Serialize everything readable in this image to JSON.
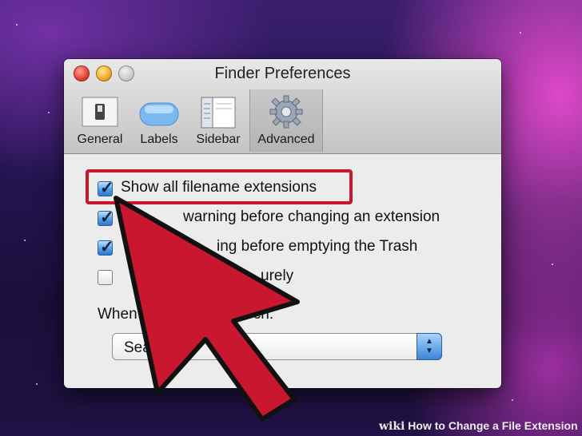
{
  "window": {
    "title": "Finder Preferences"
  },
  "toolbar": {
    "tabs": [
      {
        "label": "General",
        "icon": "switch-icon"
      },
      {
        "label": "Labels",
        "icon": "label-pill-icon"
      },
      {
        "label": "Sidebar",
        "icon": "sidebar-window-icon"
      },
      {
        "label": "Advanced",
        "icon": "gear-icon",
        "selected": true
      }
    ]
  },
  "options": [
    {
      "label": "Show all filename extensions",
      "checked": true
    },
    {
      "label": "warning before changing an extension",
      "checked": true
    },
    {
      "label": "ing before emptying the Trash",
      "checked": true
    },
    {
      "label": "urely",
      "checked": false
    }
  ],
  "search": {
    "label": "When",
    "label_end": "a search:",
    "select_value": "Sea"
  },
  "watermark": {
    "brand": "wiki",
    "text": "How to Change a File Extension"
  },
  "colors": {
    "highlight": "#c8172e",
    "cursor_fill": "#c8172e",
    "accent": "#3a86d8"
  }
}
